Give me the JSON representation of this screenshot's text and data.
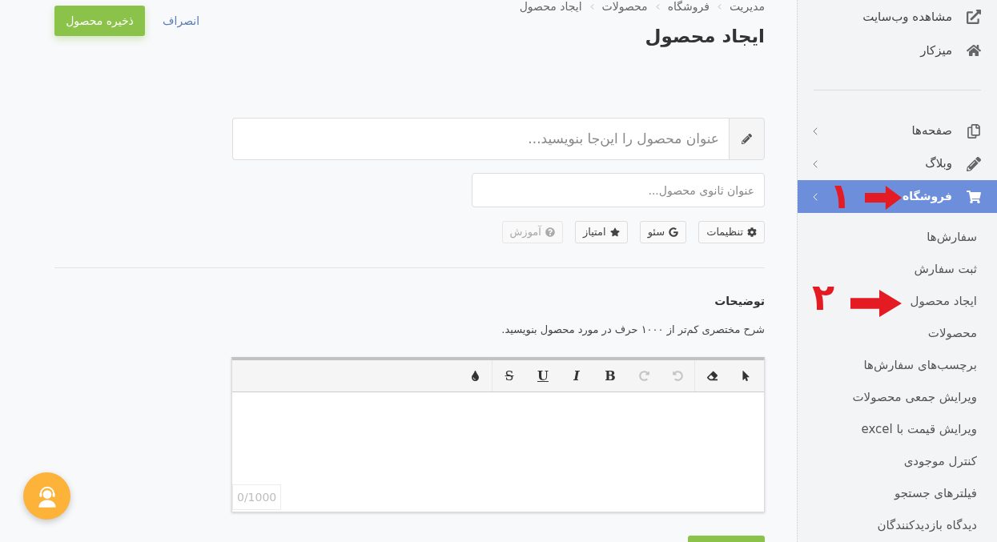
{
  "sidebar": {
    "links": [
      {
        "label": "مشاهده وب‌سایت"
      },
      {
        "label": "میزکار"
      }
    ],
    "menu": [
      {
        "label": "صفحه‌ها",
        "selected": false,
        "has_submenu": true
      },
      {
        "label": "وبلاگ",
        "selected": false,
        "has_submenu": true
      },
      {
        "label": "فروشگاه",
        "selected": true,
        "has_submenu": true,
        "children": [
          {
            "label": "سفارش‌ها",
            "selected": false
          },
          {
            "label": "ثبت سفارش",
            "selected": false
          },
          {
            "label": "ایجاد محصول",
            "selected": false
          },
          {
            "label": "محصولات",
            "selected": false
          },
          {
            "label": "برچسب‌های سفارش‌ها",
            "selected": false
          },
          {
            "label": "ویرایش جمعی محصولات",
            "selected": false
          },
          {
            "label": "ویرایش قیمت با excel",
            "selected": false
          },
          {
            "label": "کنترل موجودی",
            "selected": false
          },
          {
            "label": "فیلترهای جستجو",
            "selected": false
          },
          {
            "label": "دیدگاه بازدیدکنندگان",
            "selected": false
          }
        ]
      }
    ]
  },
  "annotations": [
    {
      "number": "۱"
    },
    {
      "number": "۲"
    }
  ],
  "header": {
    "breadcrumb": [
      "مدیریت",
      "فروشگاه",
      "محصولات",
      "ایجاد محصول"
    ],
    "title": "ایجاد محصول",
    "cancel": "انصراف",
    "save": "ذخیره محصول"
  },
  "form": {
    "title_field": {
      "placeholder": "عنوان محصول را این‌جا بنویسید..."
    },
    "subtitle_field": {
      "placeholder": "عنوان ثانوی محصول..."
    },
    "option_buttons": [
      {
        "label": "تنظیمات",
        "disabled": false
      },
      {
        "label": "سئو",
        "disabled": false
      },
      {
        "label": "امتیاز",
        "disabled": false
      },
      {
        "label": "آموزش",
        "disabled": true
      }
    ]
  },
  "description": {
    "label": "توضیحات",
    "hint": "شرح مختصری کم‌تر از ۱۰۰۰ حرف در مورد محصول بنویسید.",
    "editor": {
      "toolbar": [
        [
          {
            "kind": "pointer",
            "disabled": false
          },
          {
            "kind": "eraser",
            "disabled": false
          }
        ],
        [
          {
            "kind": "undo",
            "disabled": true
          },
          {
            "kind": "redo",
            "disabled": true
          },
          {
            "kind": "bold",
            "label": "B",
            "disabled": false
          },
          {
            "kind": "italic",
            "label": "I",
            "disabled": false
          },
          {
            "kind": "underline",
            "label": "U",
            "disabled": false
          },
          {
            "kind": "strikethrough",
            "label": "S",
            "disabled": false
          }
        ],
        [
          {
            "kind": "color",
            "disabled": false
          }
        ]
      ],
      "counter": "0/1000"
    }
  }
}
